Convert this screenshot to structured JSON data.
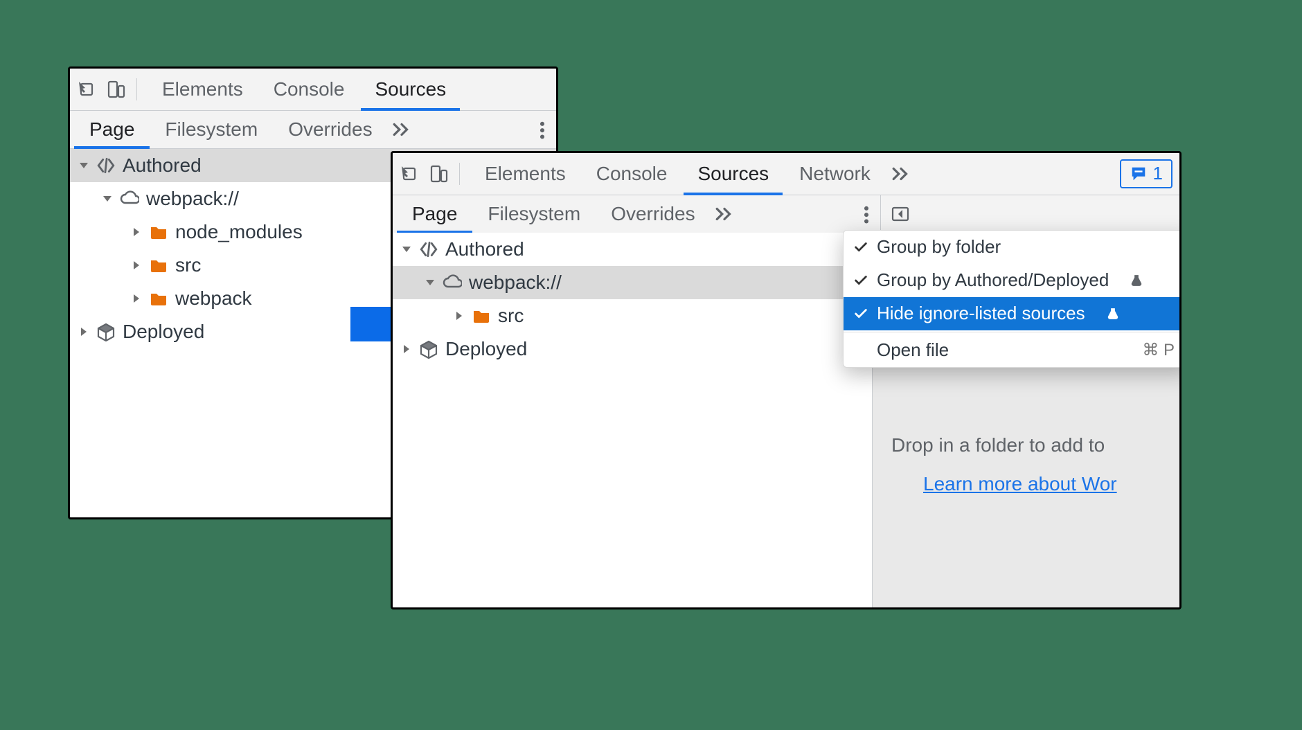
{
  "colors": {
    "accent": "#1a73e8",
    "folder": "#e8710a"
  },
  "issues_badge_count": "1",
  "toolbar_tabs": {
    "elements": "Elements",
    "console": "Console",
    "sources": "Sources",
    "network": "Network"
  },
  "sub_tabs": {
    "page": "Page",
    "filesystem": "Filesystem",
    "overrides": "Overrides"
  },
  "tree_left": {
    "authored": "Authored",
    "webpack": "webpack://",
    "node_mods": "node_modules",
    "src": "src",
    "webpack_f": "webpack",
    "deployed": "Deployed"
  },
  "tree_right": {
    "authored": "Authored",
    "webpack": "webpack://",
    "src": "src",
    "deployed": "Deployed"
  },
  "menu": {
    "group_folder": "Group by folder",
    "group_authdep": "Group by Authored/Deployed",
    "hide_ignore": "Hide ignore-listed sources",
    "open_file": "Open file",
    "open_file_kbd": "⌘ P"
  },
  "workspace_hint": "Drop in a folder to add to",
  "workspace_link": "Learn more about Wor"
}
